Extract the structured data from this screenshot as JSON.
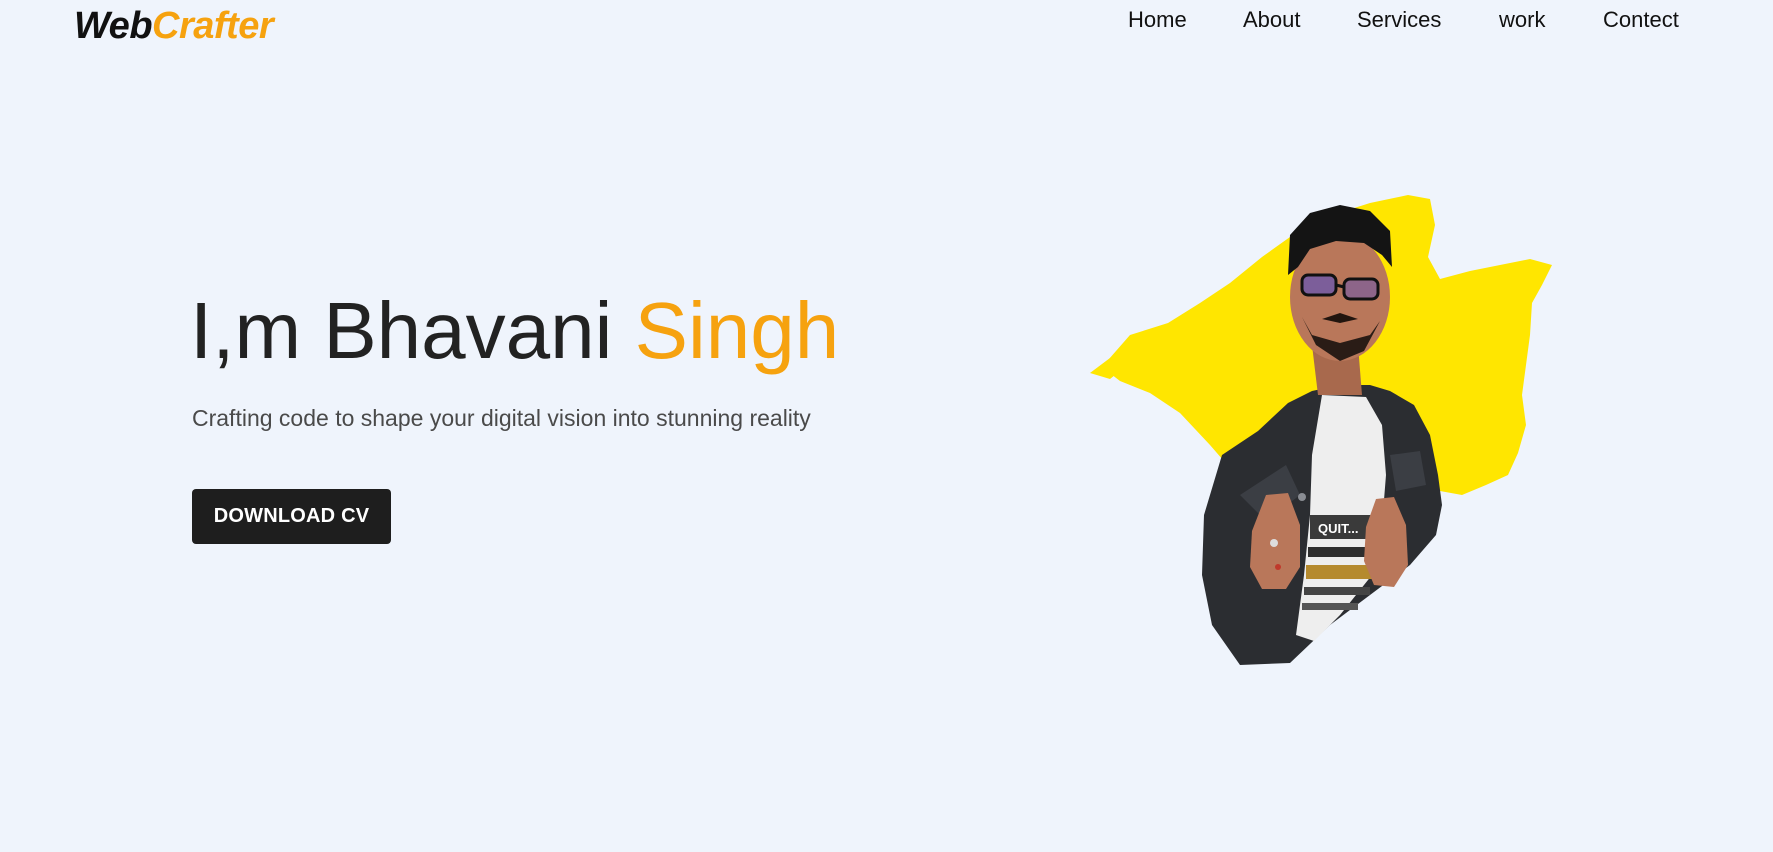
{
  "brand": {
    "part1": "Web",
    "part2": "Crafter"
  },
  "nav": {
    "items": [
      "Home",
      "About",
      "Services",
      "work",
      "Contect"
    ]
  },
  "hero": {
    "title_main": "I,m Bhavani ",
    "title_accent": "Singh",
    "subtitle": "Crafting code to shape your digital vision into stunning reality",
    "cta_label": "DOWNLOAD CV"
  },
  "shirt": {
    "print_text": "QUIT..."
  },
  "colors": {
    "background": "#eff4fc",
    "accent": "#f6a20f",
    "brush": "#ffe600",
    "button": "#1e1e1e",
    "text": "#222222"
  }
}
